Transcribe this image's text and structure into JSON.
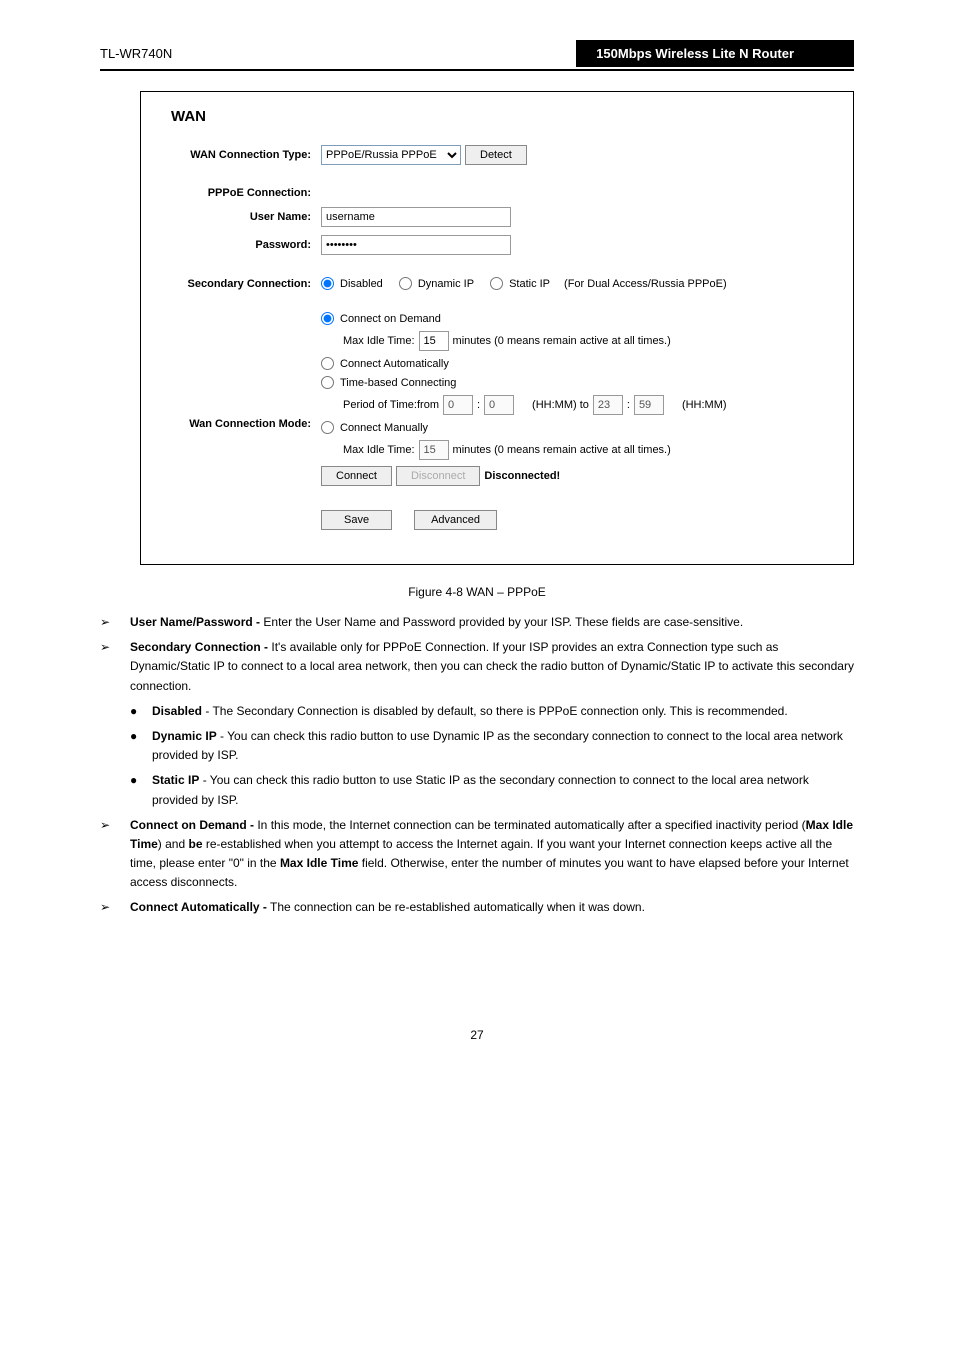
{
  "header": {
    "model": "TL-WR740N",
    "tagline": "150Mbps Wireless Lite N Router"
  },
  "panel": {
    "title": "WAN",
    "wan_conn_type_label": "WAN Connection Type:",
    "wan_conn_type_value": "PPPoE/Russia PPPoE",
    "detect_btn": "Detect",
    "pppoe_section": "PPPoE Connection:",
    "username_label": "User Name:",
    "username_value": "username",
    "password_label": "Password:",
    "password_value": "••••••••",
    "secondary_label": "Secondary Connection:",
    "sec_disabled": "Disabled",
    "sec_dynamic": "Dynamic IP",
    "sec_static": "Static IP",
    "sec_note": "(For Dual Access/Russia PPPoE)",
    "wan_mode_label": "Wan Connection Mode:",
    "mode_cod": "Connect on Demand",
    "max_idle_label": "Max Idle Time:",
    "max_idle_value1": "15",
    "minutes_note": "minutes (0 means remain active at all times.)",
    "mode_auto": "Connect Automatically",
    "mode_time": "Time-based Connecting",
    "period_label": "Period of Time:from",
    "time_from_h": "0",
    "time_from_m": "0",
    "hhmm_to": "(HH:MM) to",
    "time_to_h": "23",
    "time_to_m": "59",
    "hhmm": "(HH:MM)",
    "mode_manual": "Connect Manually",
    "max_idle_value2": "15",
    "connect_btn": "Connect",
    "disconnect_btn": "Disconnect",
    "status": "Disconnected!",
    "save_btn": "Save",
    "advanced_btn": "Advanced"
  },
  "figure_caption": "Figure 4-8 WAN – PPPoE",
  "desc": {
    "d1": " Enter the User Name and Password provided by your ISP. These fields are case-sensitive.",
    "d1_label": "User Name/Password -",
    "d2_label": "Secondary Connection -",
    "d2": " It's available only for PPPoE Connection. If your ISP provides an extra Connection type such as Dynamic/Static IP to connect to a local area network, then you can check the radio button of Dynamic/Static IP to activate this secondary connection.",
    "sub1_label": "Disabled",
    "sub1": " - The Secondary Connection is disabled by default, so there is PPPoE connection only. This is recommended.",
    "sub2_label": "Dynamic IP",
    "sub2": " - You can check this radio button to use Dynamic IP as the secondary connection to connect to the local area network provided by ISP.",
    "sub3_label": "Static IP",
    "sub3": " - You can check this radio button to use Static IP as the secondary connection to connect to the local area network provided by ISP.",
    "d3_label": "Connect on Demand -",
    "d3": " In this mode, the Internet connection can be terminated automatically after a specified inactivity period (",
    "d3b": "Max Idle Time",
    "d3c": ") and ",
    "d3d": "be",
    "d3e": " re-established when you attempt to access the Internet again. If you want your Internet connection keeps active all the time, please enter \"0\" in the ",
    "d3f": "Max Idle Time",
    "d3g": " field. Otherwise, enter the number of minutes you want to have elapsed before your Internet access disconnects.",
    "d4_label": "Connect Automatically -",
    "d4": " The connection can be re-established automatically when it was down."
  },
  "page_num": "27"
}
